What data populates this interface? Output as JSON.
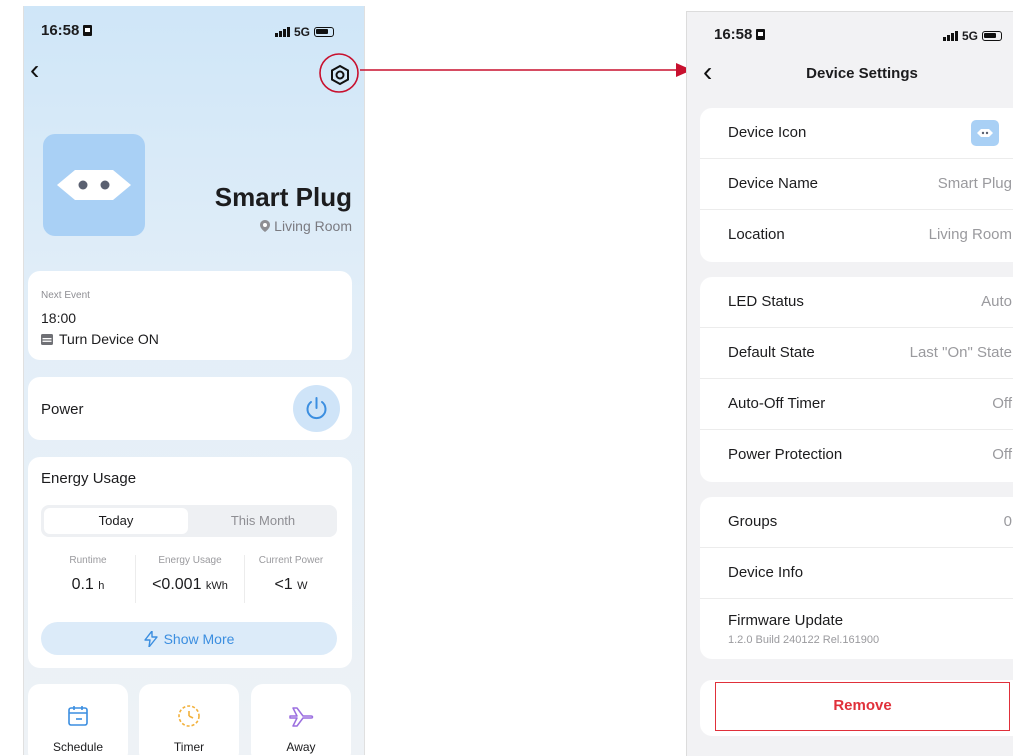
{
  "left": {
    "status": {
      "time": "16:58",
      "network": "5G"
    },
    "device": {
      "name": "Smart Plug",
      "room": "Living Room"
    },
    "next_event": {
      "label": "Next Event",
      "time": "18:00",
      "action": "Turn Device ON"
    },
    "power": {
      "label": "Power"
    },
    "energy": {
      "title": "Energy Usage",
      "tabs": [
        "Today",
        "This Month"
      ],
      "selected_tab": "Today",
      "stats": [
        {
          "label": "Runtime",
          "value": "0.1",
          "unit": "h"
        },
        {
          "label": "Energy Usage",
          "value": "<0.001",
          "unit": "kWh"
        },
        {
          "label": "Current Power",
          "value": "<1",
          "unit": "W"
        }
      ],
      "show_more": "Show More"
    },
    "actions": [
      {
        "label": "Schedule",
        "icon": "calendar-icon"
      },
      {
        "label": "Timer",
        "icon": "clock-icon"
      },
      {
        "label": "Away",
        "icon": "airplane-icon"
      }
    ]
  },
  "right": {
    "status": {
      "time": "16:58",
      "network": "5G"
    },
    "title": "Device Settings",
    "group1": [
      {
        "label": "Device Icon",
        "value": ""
      },
      {
        "label": "Device Name",
        "value": "Smart Plug"
      },
      {
        "label": "Location",
        "value": "Living Room"
      }
    ],
    "group2": [
      {
        "label": "LED Status",
        "value": "Auto"
      },
      {
        "label": "Default State",
        "value": "Last \"On\" State"
      },
      {
        "label": "Auto-Off Timer",
        "value": "Off"
      },
      {
        "label": "Power Protection",
        "value": "Off"
      }
    ],
    "group3": [
      {
        "label": "Groups",
        "value": "0"
      },
      {
        "label": "Device Info",
        "value": ""
      },
      {
        "label": "Firmware Update",
        "value": "",
        "sub": "1.2.0 Build 240122 Rel.161900"
      }
    ],
    "remove": "Remove"
  },
  "colors": {
    "accent_blue": "#3b8ee0",
    "device_tile": "#a9d0f5",
    "annotation_red": "#d0021b",
    "remove_red": "#e0303a"
  }
}
